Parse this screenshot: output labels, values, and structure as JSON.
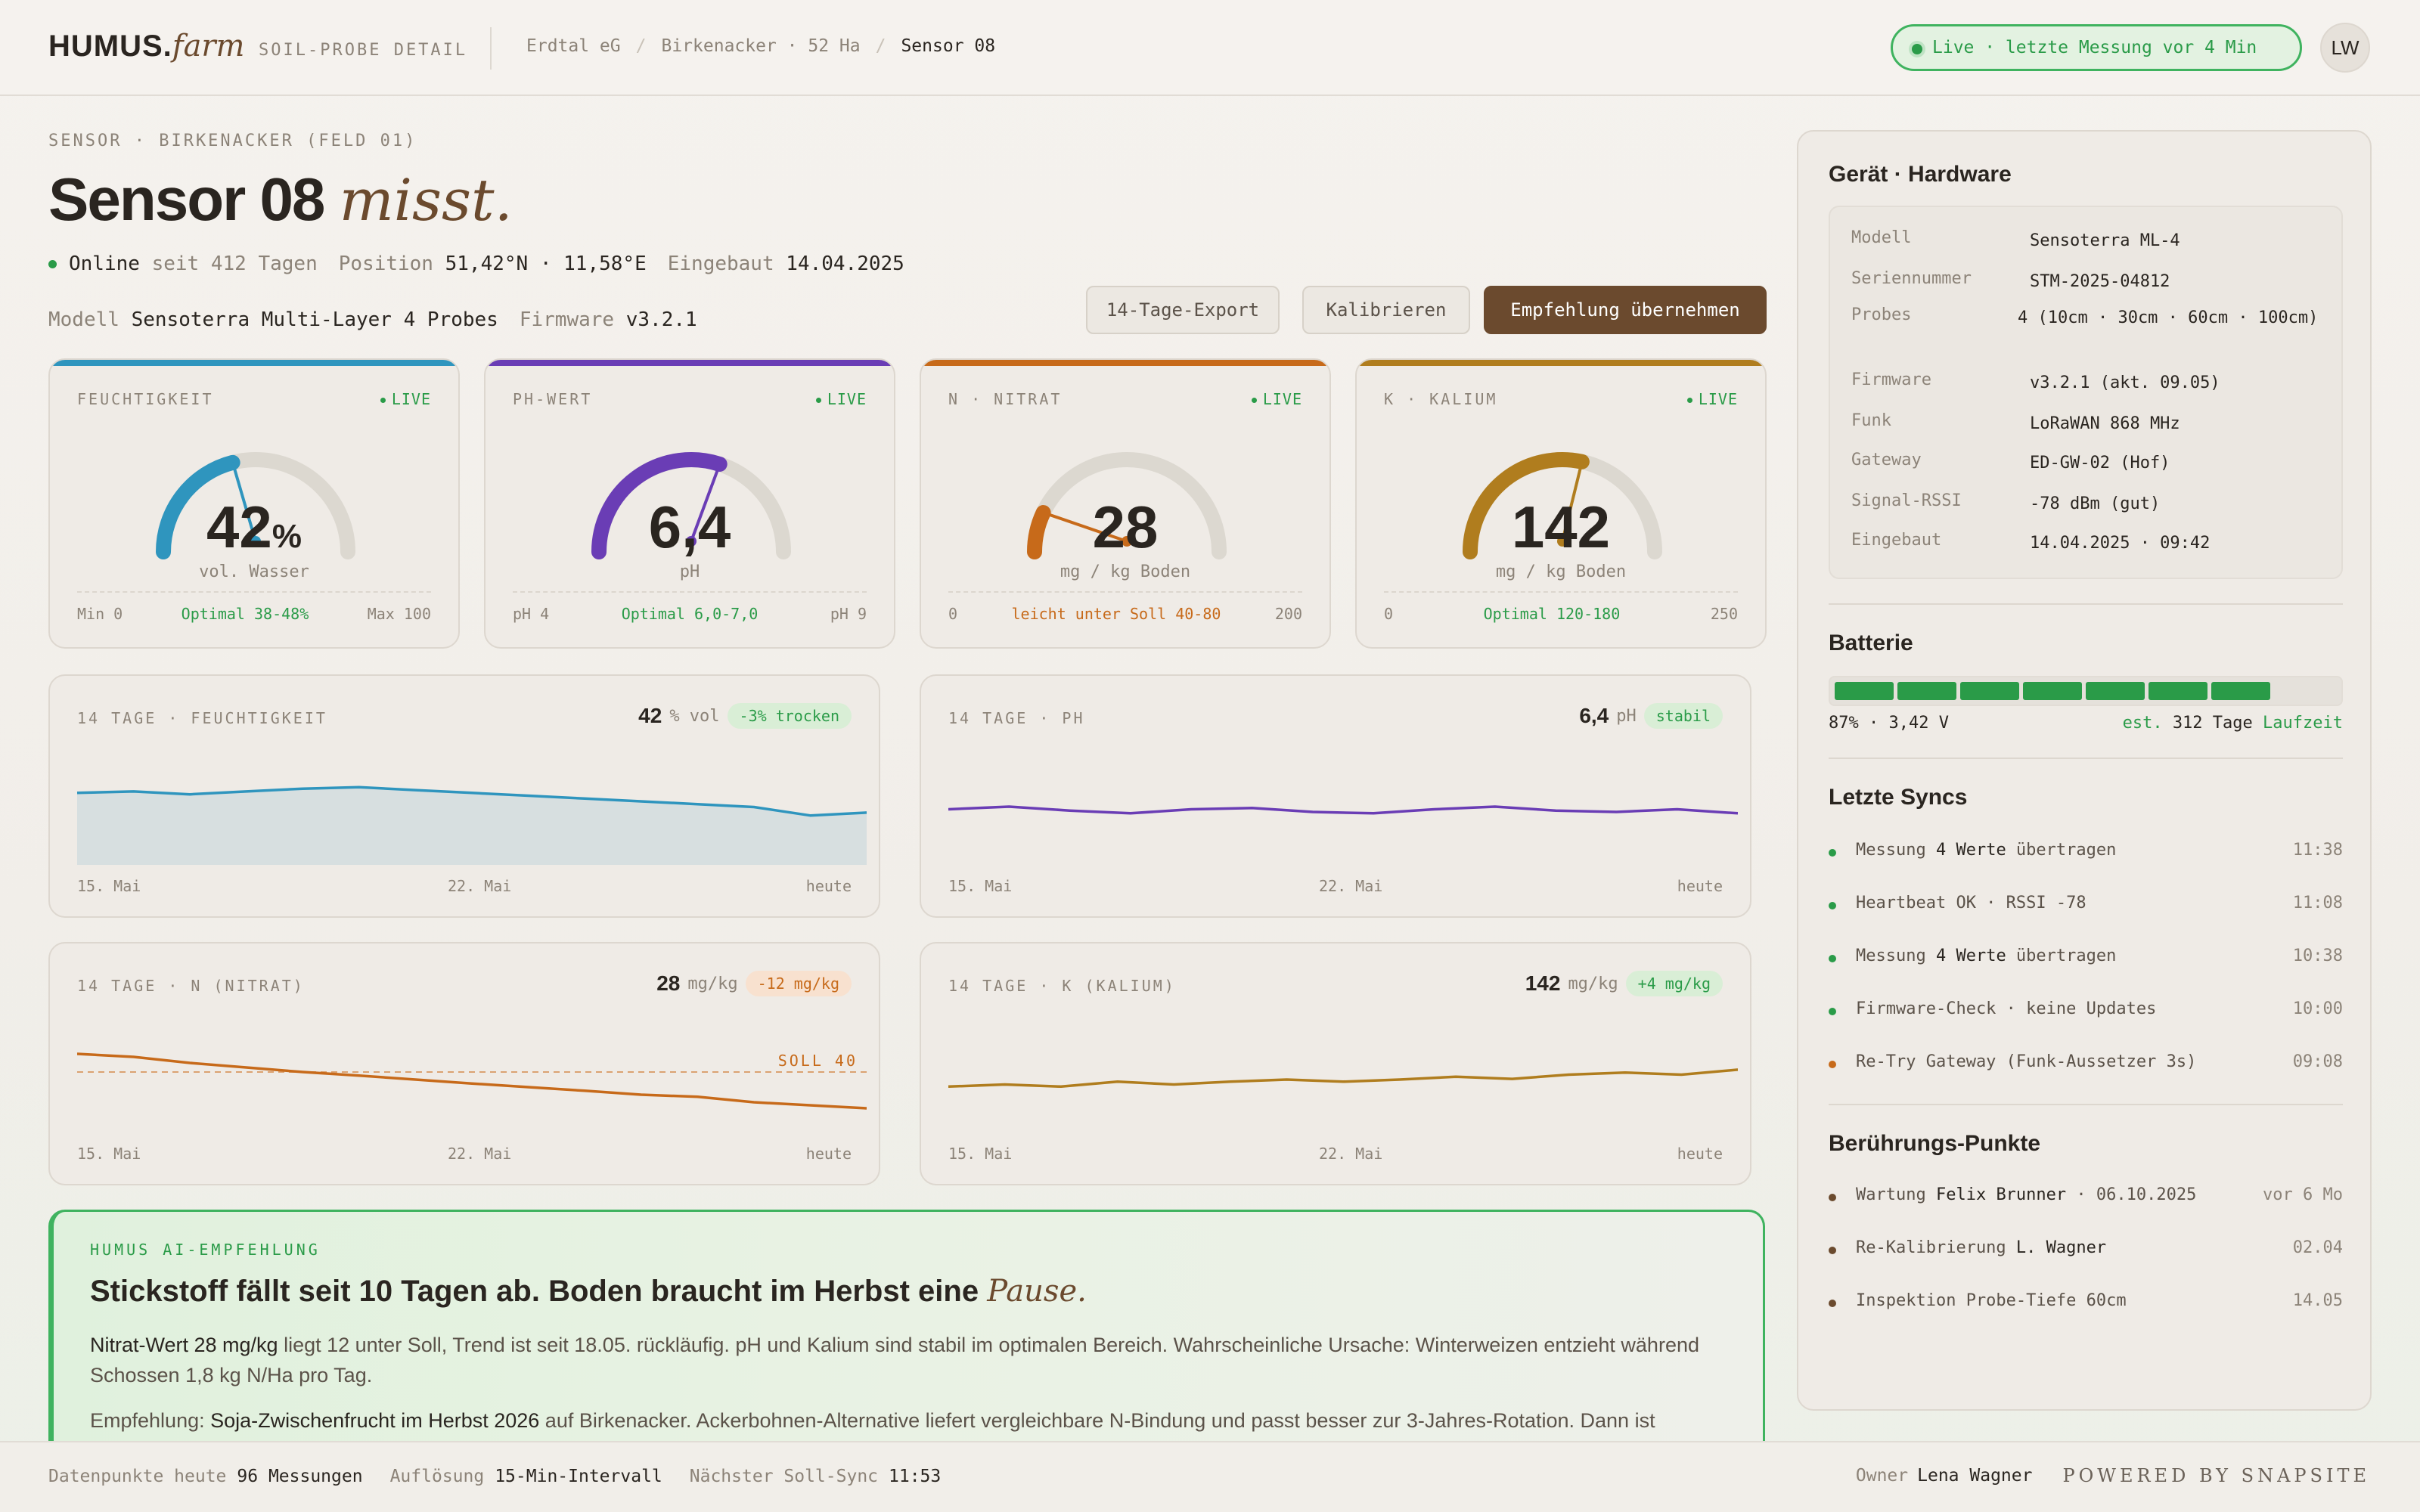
{
  "header": {
    "logo_main": "HUMUS.",
    "logo_farm": "farm",
    "subtitle": "SOIL-PROBE DETAIL",
    "breadcrumb": [
      "Erdtal eG",
      "Birkenacker · 52 Ha",
      "Sensor 08"
    ],
    "live_status": "Live · letzte Messung vor 4 Min",
    "avatar": "LW"
  },
  "sensor": {
    "eyebrow": "SENSOR · BIRKENACKER (FELD 01)",
    "title": "Sensor 08",
    "title_em": "misst.",
    "online_label": "Online",
    "online_since": "seit 412 Tagen",
    "position_label": "Position",
    "position_value": "51,42°N · 11,58°E",
    "installed_label": "Eingebaut",
    "installed_value": "14.04.2025",
    "model_label": "Modell",
    "model_value": "Sensoterra Multi-Layer 4 Probes",
    "firmware_label": "Firmware",
    "firmware_value": "v3.2.1"
  },
  "actions": {
    "export": "14-Tage-Export",
    "calibrate": "Kalibrieren",
    "apply": "Empfehlung übernehmen"
  },
  "gauges": [
    {
      "label": "FEUCHTIGKEIT",
      "live": "LIVE",
      "value": "42",
      "unit_suffix": "%",
      "unit": "vol. Wasser",
      "min": "Min 0",
      "range": "Optimal 38-48%",
      "max": "Max 100",
      "status": "ok",
      "fraction": 0.42,
      "color": "#2f95be"
    },
    {
      "label": "PH-WERT",
      "live": "LIVE",
      "value": "6,4",
      "unit_suffix": "",
      "unit": "pH",
      "min": "pH 4",
      "range": "Optimal 6,0-7,0",
      "max": "pH 9",
      "status": "ok",
      "fraction": 0.6,
      "color": "#6a3db5"
    },
    {
      "label": "N · NITRAT",
      "live": "LIVE",
      "value": "28",
      "unit_suffix": "",
      "unit": "mg / kg Boden",
      "min": "0",
      "range": "leicht unter Soll 40-80",
      "max": "200",
      "status": "warn",
      "fraction": 0.14,
      "color": "#c76a1a"
    },
    {
      "label": "K · KALIUM",
      "live": "LIVE",
      "value": "142",
      "unit_suffix": "",
      "unit": "mg / kg Boden",
      "min": "0",
      "range": "Optimal 120-180",
      "max": "250",
      "status": "ok",
      "fraction": 0.568,
      "color": "#b07d1e"
    }
  ],
  "trends": [
    {
      "label": "14 TAGE · FEUCHTIGKEIT",
      "value": "42",
      "unit": "% vol",
      "chip": "-3% trocken",
      "chip_type": "g",
      "x_start": "15. Mai",
      "x_mid": "22. Mai",
      "x_end": "heute",
      "color": "#2f95be",
      "area": true,
      "chart_data": {
        "type": "area",
        "x": [
          "15. Mai",
          "",
          "",
          "",
          "",
          "",
          "",
          "22. Mai",
          "",
          "",
          "",
          "",
          "",
          "heute"
        ],
        "values": [
          45.2,
          45.4,
          45.0,
          45.4,
          45.8,
          46.0,
          45.6,
          45.2,
          44.8,
          44.4,
          44.0,
          43.6,
          43.2,
          42.0,
          42.4
        ],
        "ylim": [
          35,
          50
        ]
      }
    },
    {
      "label": "14 TAGE · PH",
      "value": "6,4",
      "unit": "pH",
      "chip": "stabil",
      "chip_type": "g",
      "x_start": "15. Mai",
      "x_mid": "22. Mai",
      "x_end": "heute",
      "color": "#6a3db5",
      "area": false,
      "chart_data": {
        "type": "line",
        "x": [
          "15. Mai",
          "",
          "",
          "",
          "",
          "",
          "",
          "22. Mai",
          "",
          "",
          "",
          "",
          "",
          "heute"
        ],
        "values": [
          6.42,
          6.44,
          6.41,
          6.39,
          6.42,
          6.43,
          6.4,
          6.39,
          6.42,
          6.44,
          6.41,
          6.4,
          6.42,
          6.39
        ],
        "ylim": [
          6.0,
          6.8
        ]
      }
    },
    {
      "label": "14 TAGE · N (NITRAT)",
      "value": "28",
      "unit": "mg/kg",
      "chip": "-12 mg/kg",
      "chip_type": "o",
      "x_start": "15. Mai",
      "x_mid": "22. Mai",
      "x_end": "heute",
      "color": "#c76a1a",
      "area": false,
      "soll": 40,
      "soll_label": "SOLL 40",
      "chart_data": {
        "type": "line",
        "x": [
          "15. Mai",
          "",
          "",
          "",
          "",
          "",
          "",
          "22. Mai",
          "",
          "",
          "",
          "",
          "",
          "heute"
        ],
        "values": [
          46,
          45,
          43,
          41.5,
          40,
          38.8,
          37.5,
          36.2,
          35,
          33.8,
          32.5,
          31.8,
          30,
          29,
          28
        ],
        "ylim": [
          20,
          55
        ]
      }
    },
    {
      "label": "14 TAGE · K (KALIUM)",
      "value": "142",
      "unit": "mg/kg",
      "chip": "+4 mg/kg",
      "chip_type": "g",
      "x_start": "15. Mai",
      "x_mid": "22. Mai",
      "x_end": "heute",
      "color": "#b07d1e",
      "area": false,
      "chart_data": {
        "type": "line",
        "x": [
          "15. Mai",
          "",
          "",
          "",
          "",
          "",
          "",
          "22. Mai",
          "",
          "",
          "",
          "",
          "",
          "heute"
        ],
        "values": [
          138,
          138.6,
          138,
          139.4,
          138.6,
          139.4,
          140,
          139.4,
          140,
          140.8,
          140.2,
          141.4,
          142,
          141.4,
          142.8
        ],
        "ylim": [
          125,
          155
        ]
      }
    }
  ],
  "ai": {
    "eyebrow": "HUMUS AI-EMPFEHLUNG",
    "headline": "Stickstoff fällt seit 10 Tagen ab. Boden braucht im Herbst eine",
    "headline_em": "Pause.",
    "p1_strong": "Nitrat-Wert 28 mg/kg",
    "p1_rest": " liegt 12 unter Soll, Trend ist seit 18.05. rückläufig. pH und Kalium sind stabil im optimalen Bereich. Wahrscheinliche Ursache: Winterweizen entzieht während Schossen 1,8 kg N/Ha pro Tag.",
    "p2_lead": "Empfehlung: ",
    "p2_strong": "Soja-Zwischenfrucht im Herbst 2026",
    "p2_rest": " auf Birkenacker. Ackerbohnen-Alternative liefert vergleichbare N-Bindung und passt besser zur 3-Jahres-Rotation. Dann ist"
  },
  "hardware": {
    "title": "Gerät · Hardware",
    "rows": [
      {
        "k": "Modell",
        "v": "Sensoterra ML-4"
      },
      {
        "k": "Seriennummer",
        "v": "STM-2025-04812"
      },
      {
        "k": "Probes",
        "v": "4 (10cm · 30cm · 60cm · 100cm)"
      },
      {
        "k": "Firmware",
        "v": "v3.2.1 (akt. 09.05)"
      },
      {
        "k": "Funk",
        "v": "LoRaWAN 868 MHz"
      },
      {
        "k": "Gateway",
        "v": "ED-GW-02 (Hof)"
      },
      {
        "k": "Signal-RSSI",
        "v": "-78 dBm (gut)"
      },
      {
        "k": "Eingebaut",
        "v": "14.04.2025 · 09:42"
      }
    ]
  },
  "battery": {
    "title": "Batterie",
    "level": 0.87,
    "text": "87% · 3,42 V",
    "est": "est.",
    "days": "312 Tage",
    "runtime": "Laufzeit"
  },
  "syncs": {
    "title": "Letzte Syncs",
    "items": [
      {
        "pre": "Messung ",
        "strong": "4 Werte",
        "post": " übertragen",
        "time": "11:38",
        "color": "#2a9b48"
      },
      {
        "pre": "Heartbeat OK · RSSI -78",
        "strong": "",
        "post": "",
        "time": "11:08",
        "color": "#2a9b48"
      },
      {
        "pre": "Messung ",
        "strong": "4 Werte",
        "post": " übertragen",
        "time": "10:38",
        "color": "#2a9b48"
      },
      {
        "pre": "Firmware-Check · keine Updates",
        "strong": "",
        "post": "",
        "time": "10:00",
        "color": "#2a9b48"
      },
      {
        "pre": "Re-Try Gateway (Funk-Aussetzer 3s)",
        "strong": "",
        "post": "",
        "time": "09:08",
        "color": "#c76a1a"
      }
    ]
  },
  "touchpoints": {
    "title": "Berührungs-Punkte",
    "items": [
      {
        "pre": "Wartung ",
        "strong": "Felix Brunner",
        "post": " · 06.10.2025",
        "time": "vor 6 Mo"
      },
      {
        "pre": "Re-Kalibrierung ",
        "strong": "L. Wagner",
        "post": "",
        "time": "02.04"
      },
      {
        "pre": "Inspektion Probe-Tiefe 60cm",
        "strong": "",
        "post": "",
        "time": "14.05"
      }
    ]
  },
  "footer": {
    "dp_label": "Datenpunkte heute",
    "dp_value": "96 Messungen",
    "res_label": "Auflösung",
    "res_value": "15-Min-Intervall",
    "sync_label": "Nächster Soll-Sync",
    "sync_value": "11:53",
    "owner_label": "Owner",
    "owner_value": "Lena Wagner",
    "powered": "POWERED BY SNAPSITE"
  }
}
